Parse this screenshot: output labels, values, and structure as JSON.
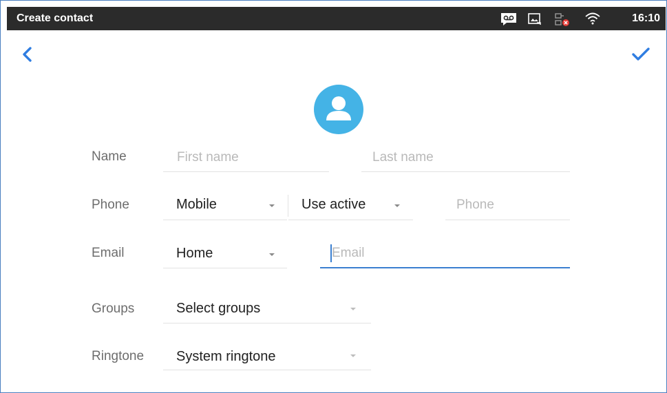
{
  "status_bar": {
    "title": "Create contact",
    "time": "16:10"
  },
  "toolbar": {
    "back_icon": "chevron-left-icon",
    "done_icon": "check-icon",
    "accent_color": "#2f7de1"
  },
  "avatar": {
    "icon": "person-icon",
    "color": "#44b3e6"
  },
  "form": {
    "name": {
      "label": "Name",
      "first_placeholder": "First name",
      "last_placeholder": "Last name"
    },
    "phone": {
      "label": "Phone",
      "type_value": "Mobile",
      "account_value": "Use active",
      "number_placeholder": "Phone"
    },
    "email": {
      "label": "Email",
      "type_value": "Home",
      "address_placeholder": "Email"
    },
    "groups": {
      "label": "Groups",
      "value": "Select groups"
    },
    "ringtone": {
      "label": "Ringtone",
      "value": "System ringtone"
    }
  }
}
